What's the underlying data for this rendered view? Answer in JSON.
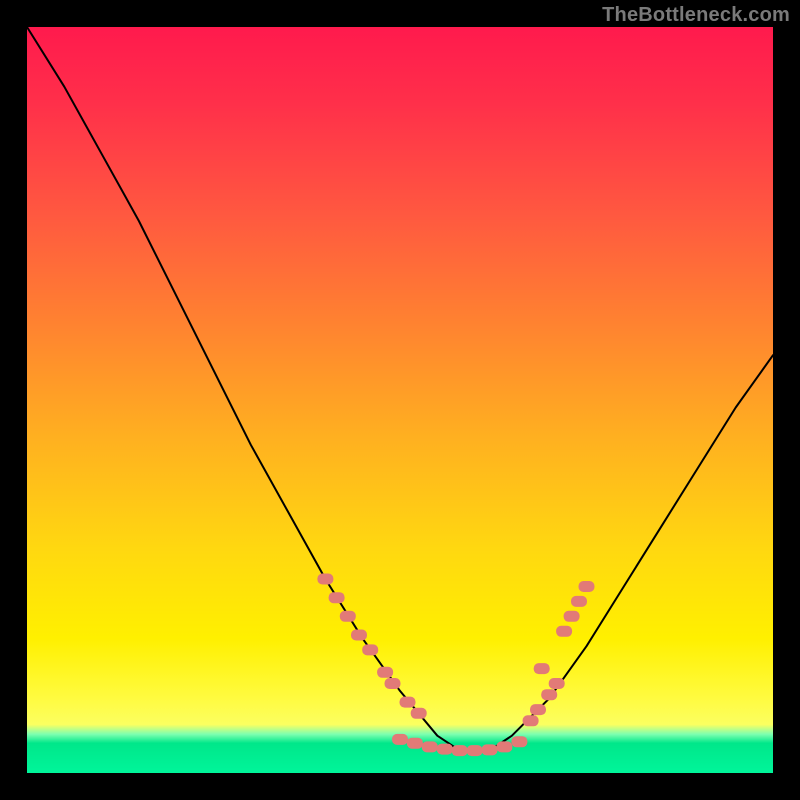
{
  "watermark": "TheBottleneck.com",
  "colors": {
    "background": "#000000",
    "curve": "#000000",
    "scatter_fill": "#e27a77",
    "gradient_top": "#ff1a4d",
    "gradient_mid": "#ffd810",
    "gradient_bottom": "#00f59a"
  },
  "chart_data": {
    "type": "line",
    "title": "",
    "xlabel": "",
    "ylabel": "",
    "xlim": [
      0,
      100
    ],
    "ylim": [
      0,
      100
    ],
    "grid": false,
    "legend": false,
    "note": "Axes have no visible tick labels; values are estimated from gridless pixel positions on a 0–100 normalized scale (y = 0 at bottom, 100 at top). Curve depicts bottleneck-percentage-style V shape with minimum near x ≈ 55–62.",
    "series": [
      {
        "name": "curve",
        "x": [
          0,
          5,
          10,
          15,
          20,
          25,
          30,
          35,
          40,
          45,
          50,
          55,
          58,
          60,
          62,
          65,
          70,
          75,
          80,
          85,
          90,
          95,
          100
        ],
        "y": [
          100,
          92,
          83,
          74,
          64,
          54,
          44,
          35,
          26,
          18,
          11,
          5,
          3,
          3,
          3,
          5,
          10,
          17,
          25,
          33,
          41,
          49,
          56
        ]
      }
    ],
    "scatter": {
      "name": "highlighted-points",
      "note": "Salmon rounded markers clustered near the curve's bottom (both descending and ascending limbs).",
      "points": [
        {
          "x": 40.0,
          "y": 26.0
        },
        {
          "x": 41.5,
          "y": 23.5
        },
        {
          "x": 43.0,
          "y": 21.0
        },
        {
          "x": 44.5,
          "y": 18.5
        },
        {
          "x": 46.0,
          "y": 16.5
        },
        {
          "x": 48.0,
          "y": 13.5
        },
        {
          "x": 49.0,
          "y": 12.0
        },
        {
          "x": 51.0,
          "y": 9.5
        },
        {
          "x": 52.5,
          "y": 8.0
        },
        {
          "x": 50.0,
          "y": 4.5
        },
        {
          "x": 52.0,
          "y": 4.0
        },
        {
          "x": 54.0,
          "y": 3.5
        },
        {
          "x": 56.0,
          "y": 3.2
        },
        {
          "x": 58.0,
          "y": 3.0
        },
        {
          "x": 60.0,
          "y": 3.0
        },
        {
          "x": 62.0,
          "y": 3.1
        },
        {
          "x": 64.0,
          "y": 3.5
        },
        {
          "x": 66.0,
          "y": 4.2
        },
        {
          "x": 67.5,
          "y": 7.0
        },
        {
          "x": 68.5,
          "y": 8.5
        },
        {
          "x": 70.0,
          "y": 10.5
        },
        {
          "x": 71.0,
          "y": 12.0
        },
        {
          "x": 72.0,
          "y": 19.0
        },
        {
          "x": 73.0,
          "y": 21.0
        },
        {
          "x": 74.0,
          "y": 23.0
        },
        {
          "x": 75.0,
          "y": 25.0
        },
        {
          "x": 69.0,
          "y": 14.0
        }
      ]
    }
  }
}
